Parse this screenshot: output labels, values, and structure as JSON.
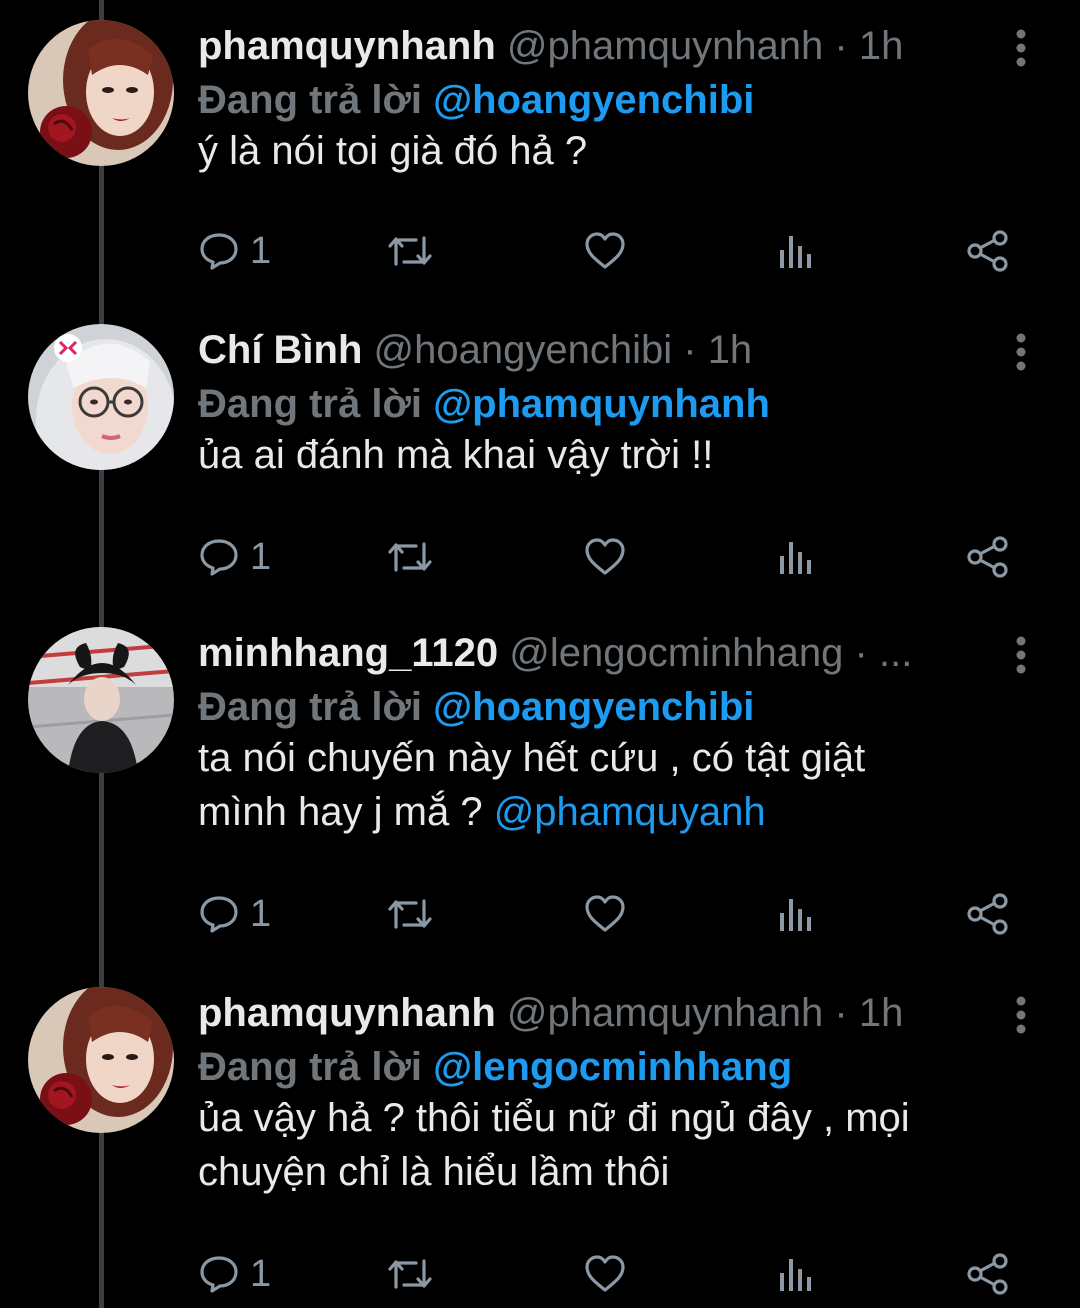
{
  "tweets": [
    {
      "name": "phamquynhanh",
      "handle": "@phamquynhanh",
      "dot": " · ",
      "time": "1h",
      "reply_label": "Đang trả lời ",
      "reply_target": "@hoangyenchibi",
      "text_lines": [
        "ý là nói toi già đó hả ?"
      ],
      "mention": "",
      "reply_count": "1",
      "avatar": "rose-portrait"
    },
    {
      "name": "Chí Bình",
      "handle": "@hoangyenchibi",
      "dot": " · ",
      "time": "1h",
      "reply_label": "Đang trả lời ",
      "reply_target": "@phamquynhanh",
      "text_lines": [
        "ủa ai đánh mà khai vậy trời !!"
      ],
      "mention": "",
      "reply_count": "1",
      "avatar": "glasses-portrait"
    },
    {
      "name": "minhhang_1120",
      "handle": "@lengocminhhang",
      "dot": " · ...",
      "time": "",
      "reply_label": "Đang trả lời ",
      "reply_target": "@hoangyenchibi",
      "text_lines": [
        "ta nói chuyến này hết cứu , có tật giật",
        "mình hay j mắ ? "
      ],
      "mention": "@phamquyanh",
      "reply_count": "1",
      "avatar": "hat-portrait"
    },
    {
      "name": "phamquynhanh",
      "handle": "@phamquynhanh",
      "dot": " · ",
      "time": "1h",
      "reply_label": "Đang trả lời ",
      "reply_target": "@lengocminhhang",
      "text_lines": [
        "ủa vậy hả ? thôi tiểu nữ đi ngủ đây , mọi",
        "chuyện chỉ là hiểu lầm thôi"
      ],
      "mention": "",
      "reply_count": "1",
      "avatar": "rose-portrait"
    }
  ],
  "icons": {
    "reply": "reply-icon",
    "retweet": "retweet-icon",
    "like": "heart-icon",
    "views": "views-icon",
    "share": "share-icon",
    "more": "more-icon"
  },
  "colors": {
    "background": "#000000",
    "text": "#e7e9ea",
    "muted": "#71767b",
    "link": "#1d9bf0",
    "thread_line": "#3b3f43"
  }
}
